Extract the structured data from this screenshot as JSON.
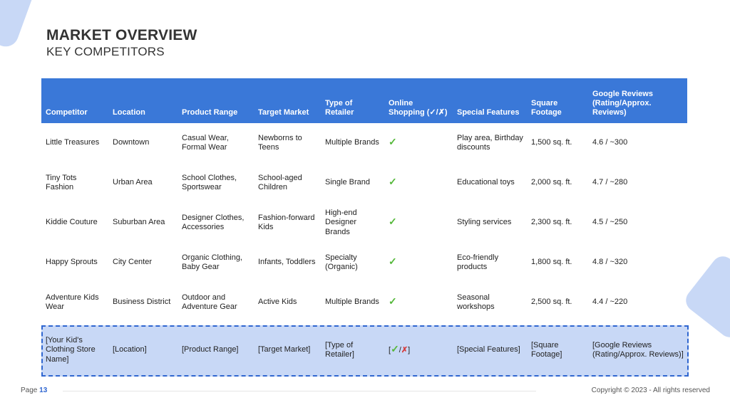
{
  "slide": {
    "title": "MARKET OVERVIEW",
    "subtitle": "KEY COMPETITORS"
  },
  "table": {
    "headers": [
      "Competitor",
      "Location",
      "Product Range",
      "Target Market",
      "Type of Retailer",
      "Online Shopping (✓/✗)",
      "Special Features",
      "Square Footage",
      "Google Reviews (Rating/Approx. Reviews)"
    ],
    "rows": [
      [
        "Little Treasures",
        "Downtown",
        "Casual Wear, Formal Wear",
        "Newborns to Teens",
        "Multiple Brands",
        "✓",
        "Play area, Birthday discounts",
        "1,500 sq. ft.",
        "4.6 / ~300"
      ],
      [
        "Tiny Tots Fashion",
        "Urban Area",
        "School Clothes, Sportswear",
        "School-aged Children",
        "Single Brand",
        "✓",
        "Educational toys",
        "2,000 sq. ft.",
        "4.7 / ~280"
      ],
      [
        "Kiddie Couture",
        "Suburban Area",
        "Designer Clothes, Accessories",
        "Fashion-forward Kids",
        "High-end Designer Brands",
        "✓",
        "Styling services",
        "2,300 sq. ft.",
        "4.5 / ~250"
      ],
      [
        "Happy Sprouts",
        "City Center",
        "Organic Clothing, Baby Gear",
        "Infants, Toddlers",
        "Specialty (Organic)",
        "✓",
        "Eco-friendly products",
        "1,800 sq. ft.",
        "4.8 / ~320"
      ],
      [
        "Adventure Kids Wear",
        "Business District",
        "Outdoor and Adventure Gear",
        "Active Kids",
        "Multiple Brands",
        "✓",
        "Seasonal workshops",
        "2,500 sq. ft.",
        "4.4 / ~220"
      ]
    ],
    "own_row": {
      "competitor": "[Your Kid's Clothing Store Name]",
      "location": "[Location]",
      "product_range": "[Product Range]",
      "target_market": "[Target Market]",
      "type_of_retailer": "[Type of Retailer]",
      "online_open": "[",
      "online_check": "✓",
      "online_sep": "/",
      "online_cross": "✗",
      "online_close": "]",
      "special_features": "[Special Features]",
      "square_footage": "[Square Footage]",
      "google_reviews": "[Google Reviews (Rating/Approx. Reviews)]"
    }
  },
  "footer": {
    "page_label": "Page",
    "page_number": "13",
    "copyright": "Copyright © 2023 - All rights reserved"
  },
  "colors": {
    "header_blue": "#3a78d8",
    "highlight_fill": "#c8d8f6",
    "check_green": "#55b83a",
    "cross_red": "#d63a3a"
  }
}
